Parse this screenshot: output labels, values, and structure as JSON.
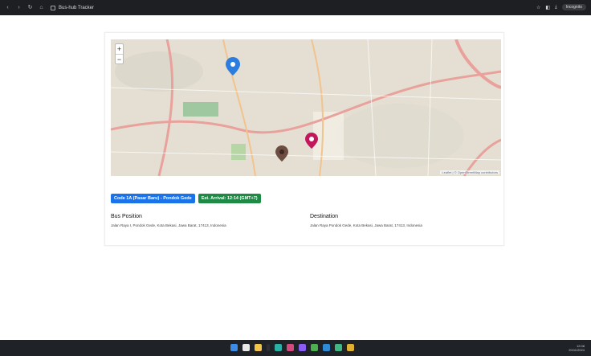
{
  "browser": {
    "tab_title": "Bus-hub Tracker",
    "profile_label": "Incognito"
  },
  "map": {
    "zoom_in": "+",
    "zoom_out": "−",
    "attribution": "Leaflet | © OpenStreetMap contributors"
  },
  "route": {
    "route_badge": "Code 1A (Pasar Baru) - Pondok Gede",
    "eta_badge": "Est. Arrival: 12:14 (GMT+7)"
  },
  "bus_position": {
    "heading": "Bus Position",
    "address": "Jalan Raya I, Pondok Gede, Kota Bekasi, Jawa Barat, 17413, Indonesia"
  },
  "destination": {
    "heading": "Destination",
    "address": "Jalan Raya Pondok Gede, Kota Bekasi, Jawa Barat, 17413, Indonesia"
  },
  "tray": {
    "time": "12:08",
    "date": "20/11/2024"
  },
  "colors": {
    "route_badge": "#1a73e8",
    "eta_badge": "#1e8a46",
    "bus_marker": "#2b7de0",
    "destination_marker": "#c2185b",
    "stop_marker": "#6d4c41"
  }
}
